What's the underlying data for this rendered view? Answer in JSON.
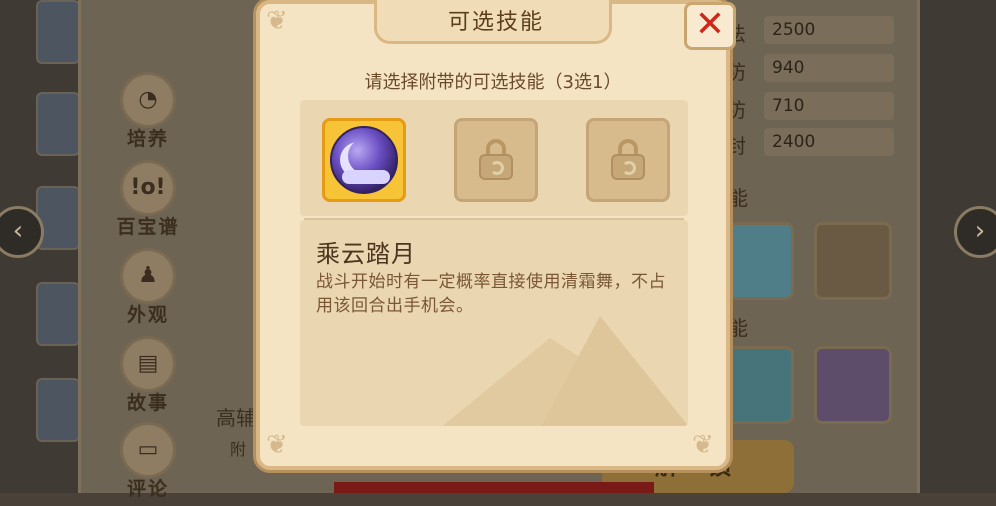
{
  "modal": {
    "title": "可选技能",
    "subtitle": "请选择附带的可选技能（3选1）",
    "selected_skill": {
      "name": "乘云踏月",
      "description": "战斗开始时有一定概率直接使用清霜舞，不占用该回合出手机会。"
    },
    "slots": [
      "selected",
      "locked",
      "locked"
    ]
  },
  "background": {
    "side_menu": [
      "培养",
      "百宝谱",
      "外观",
      "故事",
      "评论"
    ],
    "side_menu_icons": [
      "peach-icon",
      "treasure-icon",
      "outfit-icon",
      "book-icon",
      "comment-icon"
    ],
    "stats": [
      {
        "label": "法",
        "value": "2500"
      },
      {
        "label": "防",
        "value": "940"
      },
      {
        "label": "防",
        "value": "710"
      },
      {
        "label": "封",
        "value": "2400"
      }
    ],
    "section_labels": [
      "能",
      "能"
    ],
    "bottom_left_title": "高辅",
    "bottom_left_sub": "附",
    "unlock_button": "解 锁"
  },
  "colors": {
    "modal_bg": "#f4e4c3",
    "accent_gold": "#f6c436",
    "close_red": "#d0261a"
  }
}
